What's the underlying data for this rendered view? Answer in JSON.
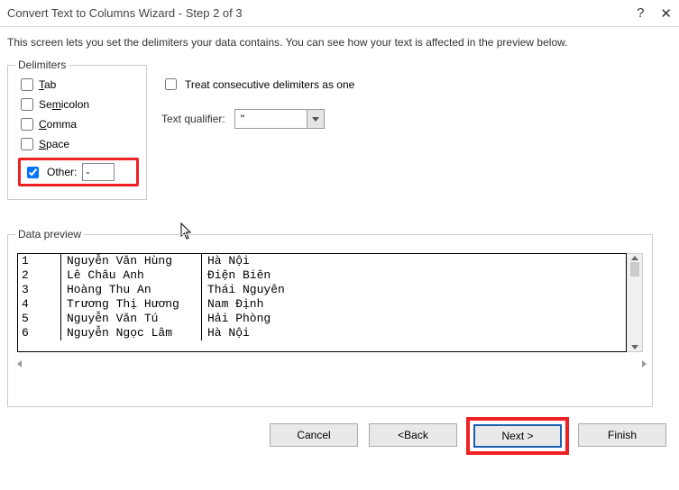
{
  "title": "Convert Text to Columns Wizard - Step 2 of 3",
  "description": "This screen lets you set the delimiters your data contains.  You can see how your text is affected in the preview below.",
  "delimiters": {
    "legend": "Delimiters",
    "tab": "Tab",
    "semicolon": "Semicolon",
    "comma": "Comma",
    "space": "Space",
    "other": "Other:",
    "other_value": "-",
    "tab_checked": false,
    "semicolon_checked": false,
    "comma_checked": false,
    "space_checked": false,
    "other_checked": true
  },
  "treat_label": "Treat consecutive delimiters as one",
  "treat_checked": false,
  "qualifier_label": "Text qualifier:",
  "qualifier_value": "\"",
  "preview": {
    "legend": "Data preview",
    "rows": [
      {
        "a": "1",
        "b": "Nguyễn Văn Hùng",
        "c": "Hà Nội"
      },
      {
        "a": "2",
        "b": "Lê Châu Anh",
        "c": "Điện Biên"
      },
      {
        "a": "3",
        "b": "Hoàng Thu An",
        "c": "Thái Nguyên"
      },
      {
        "a": "4",
        "b": "Trương Thị Hương",
        "c": "Nam Định"
      },
      {
        "a": "5",
        "b": "Nguyễn Văn Tú",
        "c": "Hải Phòng"
      },
      {
        "a": "6",
        "b": "Nguyễn Ngọc Lâm",
        "c": "Hà Nội"
      }
    ]
  },
  "buttons": {
    "cancel": "Cancel",
    "back": "< Back",
    "next": "Next >",
    "finish": "Finish"
  }
}
